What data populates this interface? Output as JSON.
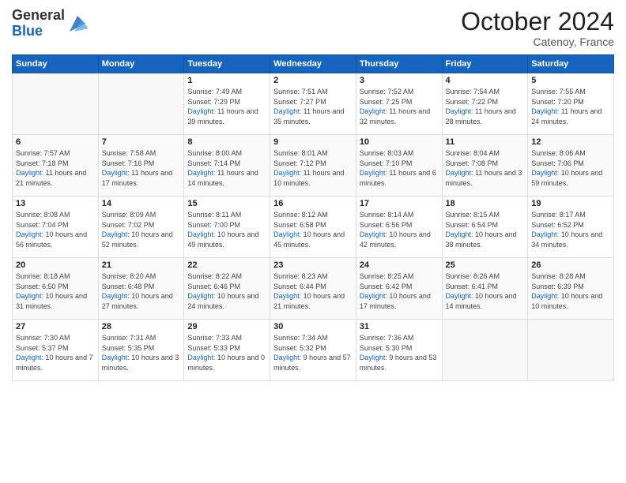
{
  "header": {
    "logo_general": "General",
    "logo_blue": "Blue",
    "month_title": "October 2024",
    "subtitle": "Catenoy, France"
  },
  "weekdays": [
    "Sunday",
    "Monday",
    "Tuesday",
    "Wednesday",
    "Thursday",
    "Friday",
    "Saturday"
  ],
  "weeks": [
    [
      {
        "day": "",
        "sunrise": "",
        "sunset": "",
        "daylight": ""
      },
      {
        "day": "",
        "sunrise": "",
        "sunset": "",
        "daylight": ""
      },
      {
        "day": "1",
        "sunrise": "Sunrise: 7:49 AM",
        "sunset": "Sunset: 7:29 PM",
        "daylight": "Daylight: 11 hours and 39 minutes."
      },
      {
        "day": "2",
        "sunrise": "Sunrise: 7:51 AM",
        "sunset": "Sunset: 7:27 PM",
        "daylight": "Daylight: 11 hours and 35 minutes."
      },
      {
        "day": "3",
        "sunrise": "Sunrise: 7:52 AM",
        "sunset": "Sunset: 7:25 PM",
        "daylight": "Daylight: 11 hours and 32 minutes."
      },
      {
        "day": "4",
        "sunrise": "Sunrise: 7:54 AM",
        "sunset": "Sunset: 7:22 PM",
        "daylight": "Daylight: 11 hours and 28 minutes."
      },
      {
        "day": "5",
        "sunrise": "Sunrise: 7:55 AM",
        "sunset": "Sunset: 7:20 PM",
        "daylight": "Daylight: 11 hours and 24 minutes."
      }
    ],
    [
      {
        "day": "6",
        "sunrise": "Sunrise: 7:57 AM",
        "sunset": "Sunset: 7:18 PM",
        "daylight": "Daylight: 11 hours and 21 minutes."
      },
      {
        "day": "7",
        "sunrise": "Sunrise: 7:58 AM",
        "sunset": "Sunset: 7:16 PM",
        "daylight": "Daylight: 11 hours and 17 minutes."
      },
      {
        "day": "8",
        "sunrise": "Sunrise: 8:00 AM",
        "sunset": "Sunset: 7:14 PM",
        "daylight": "Daylight: 11 hours and 14 minutes."
      },
      {
        "day": "9",
        "sunrise": "Sunrise: 8:01 AM",
        "sunset": "Sunset: 7:12 PM",
        "daylight": "Daylight: 11 hours and 10 minutes."
      },
      {
        "day": "10",
        "sunrise": "Sunrise: 8:03 AM",
        "sunset": "Sunset: 7:10 PM",
        "daylight": "Daylight: 11 hours and 6 minutes."
      },
      {
        "day": "11",
        "sunrise": "Sunrise: 8:04 AM",
        "sunset": "Sunset: 7:08 PM",
        "daylight": "Daylight: 11 hours and 3 minutes."
      },
      {
        "day": "12",
        "sunrise": "Sunrise: 8:06 AM",
        "sunset": "Sunset: 7:06 PM",
        "daylight": "Daylight: 10 hours and 59 minutes."
      }
    ],
    [
      {
        "day": "13",
        "sunrise": "Sunrise: 8:08 AM",
        "sunset": "Sunset: 7:04 PM",
        "daylight": "Daylight: 10 hours and 56 minutes."
      },
      {
        "day": "14",
        "sunrise": "Sunrise: 8:09 AM",
        "sunset": "Sunset: 7:02 PM",
        "daylight": "Daylight: 10 hours and 52 minutes."
      },
      {
        "day": "15",
        "sunrise": "Sunrise: 8:11 AM",
        "sunset": "Sunset: 7:00 PM",
        "daylight": "Daylight: 10 hours and 49 minutes."
      },
      {
        "day": "16",
        "sunrise": "Sunrise: 8:12 AM",
        "sunset": "Sunset: 6:58 PM",
        "daylight": "Daylight: 10 hours and 45 minutes."
      },
      {
        "day": "17",
        "sunrise": "Sunrise: 8:14 AM",
        "sunset": "Sunset: 6:56 PM",
        "daylight": "Daylight: 10 hours and 42 minutes."
      },
      {
        "day": "18",
        "sunrise": "Sunrise: 8:15 AM",
        "sunset": "Sunset: 6:54 PM",
        "daylight": "Daylight: 10 hours and 38 minutes."
      },
      {
        "day": "19",
        "sunrise": "Sunrise: 8:17 AM",
        "sunset": "Sunset: 6:52 PM",
        "daylight": "Daylight: 10 hours and 34 minutes."
      }
    ],
    [
      {
        "day": "20",
        "sunrise": "Sunrise: 8:18 AM",
        "sunset": "Sunset: 6:50 PM",
        "daylight": "Daylight: 10 hours and 31 minutes."
      },
      {
        "day": "21",
        "sunrise": "Sunrise: 8:20 AM",
        "sunset": "Sunset: 6:48 PM",
        "daylight": "Daylight: 10 hours and 27 minutes."
      },
      {
        "day": "22",
        "sunrise": "Sunrise: 8:22 AM",
        "sunset": "Sunset: 6:46 PM",
        "daylight": "Daylight: 10 hours and 24 minutes."
      },
      {
        "day": "23",
        "sunrise": "Sunrise: 8:23 AM",
        "sunset": "Sunset: 6:44 PM",
        "daylight": "Daylight: 10 hours and 21 minutes."
      },
      {
        "day": "24",
        "sunrise": "Sunrise: 8:25 AM",
        "sunset": "Sunset: 6:42 PM",
        "daylight": "Daylight: 10 hours and 17 minutes."
      },
      {
        "day": "25",
        "sunrise": "Sunrise: 8:26 AM",
        "sunset": "Sunset: 6:41 PM",
        "daylight": "Daylight: 10 hours and 14 minutes."
      },
      {
        "day": "26",
        "sunrise": "Sunrise: 8:28 AM",
        "sunset": "Sunset: 6:39 PM",
        "daylight": "Daylight: 10 hours and 10 minutes."
      }
    ],
    [
      {
        "day": "27",
        "sunrise": "Sunrise: 7:30 AM",
        "sunset": "Sunset: 5:37 PM",
        "daylight": "Daylight: 10 hours and 7 minutes."
      },
      {
        "day": "28",
        "sunrise": "Sunrise: 7:31 AM",
        "sunset": "Sunset: 5:35 PM",
        "daylight": "Daylight: 10 hours and 3 minutes."
      },
      {
        "day": "29",
        "sunrise": "Sunrise: 7:33 AM",
        "sunset": "Sunset: 5:33 PM",
        "daylight": "Daylight: 10 hours and 0 minutes."
      },
      {
        "day": "30",
        "sunrise": "Sunrise: 7:34 AM",
        "sunset": "Sunset: 5:32 PM",
        "daylight": "Daylight: 9 hours and 57 minutes."
      },
      {
        "day": "31",
        "sunrise": "Sunrise: 7:36 AM",
        "sunset": "Sunset: 5:30 PM",
        "daylight": "Daylight: 9 hours and 53 minutes."
      },
      {
        "day": "",
        "sunrise": "",
        "sunset": "",
        "daylight": ""
      },
      {
        "day": "",
        "sunrise": "",
        "sunset": "",
        "daylight": ""
      }
    ]
  ]
}
